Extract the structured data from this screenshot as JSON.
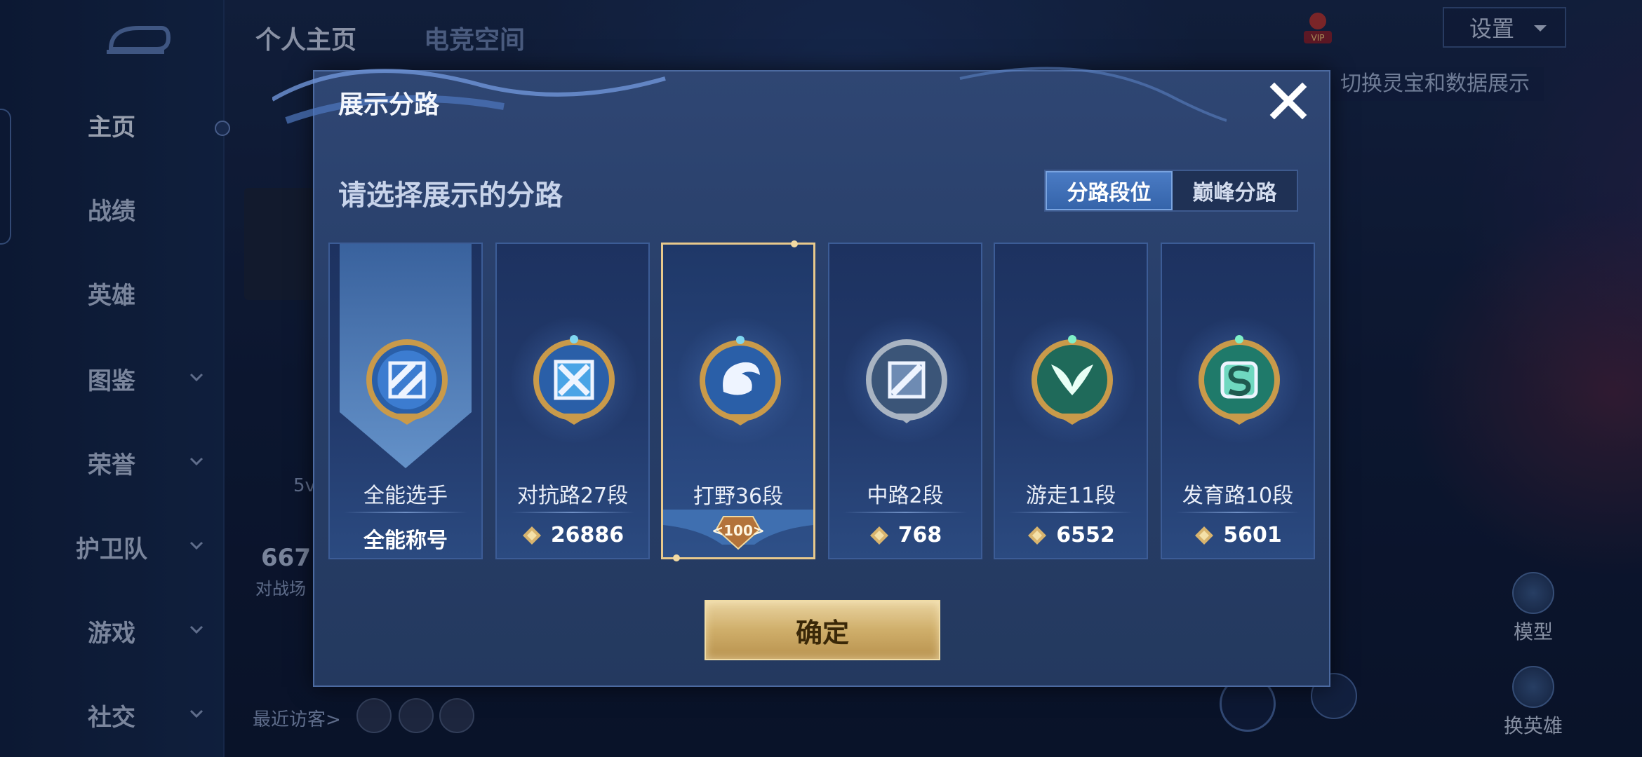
{
  "background": {
    "nav": {
      "items": [
        {
          "label": "主页",
          "chevron": false,
          "active": true
        },
        {
          "label": "战绩",
          "chevron": false
        },
        {
          "label": "英雄",
          "chevron": false
        },
        {
          "label": "图鉴",
          "chevron": true
        },
        {
          "label": "荣誉",
          "chevron": true
        },
        {
          "label": "护卫队",
          "chevron": true
        },
        {
          "label": "游戏",
          "chevron": true
        },
        {
          "label": "社交",
          "chevron": true
        }
      ]
    },
    "top_tabs": [
      "个人主页",
      "电竞空间"
    ],
    "settings_label": "设置",
    "hint": "切换灵宝和数据展示",
    "stat_value": "667",
    "stat_label": "对战场",
    "small_label": "5v",
    "visitors_label": "最近访客>",
    "model_label": "模型",
    "switch_hero_label": "换英雄"
  },
  "modal": {
    "title": "展示分路",
    "subtitle": "请选择展示的分路",
    "segments": [
      {
        "label": "分路段位",
        "active": true
      },
      {
        "label": "巅峰分路",
        "active": false
      }
    ],
    "cards": [
      {
        "name": "全能选手",
        "score": "全能称号",
        "icon": "all-round-emblem-icon",
        "selected": false
      },
      {
        "name": "对抗路27段",
        "score": "26886",
        "icon": "clash-lane-emblem-icon",
        "selected": false
      },
      {
        "name": "打野36段",
        "level": "<100>",
        "icon": "jungle-emblem-icon",
        "selected": true
      },
      {
        "name": "中路2段",
        "score": "768",
        "icon": "mid-lane-emblem-icon",
        "selected": false
      },
      {
        "name": "游走11段",
        "score": "6552",
        "icon": "roam-emblem-icon",
        "selected": false
      },
      {
        "name": "发育路10段",
        "score": "5601",
        "icon": "farm-lane-emblem-icon",
        "selected": false
      }
    ],
    "confirm_label": "确定"
  },
  "colors": {
    "modal_bg": "#2f4673",
    "selected_border": "#e8c98c",
    "segment_active": "#3f70b8",
    "confirm_gold": "#cfae6a"
  }
}
